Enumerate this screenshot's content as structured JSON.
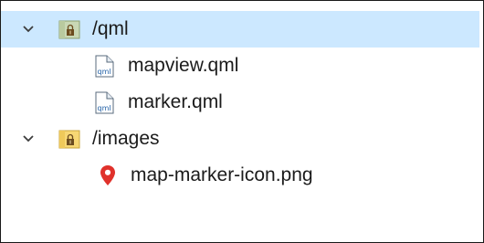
{
  "tree": {
    "folders": [
      {
        "label": "/qml",
        "expanded": true,
        "selected": true,
        "children": [
          {
            "label": "mapview.qml",
            "icon": "qml-file-icon"
          },
          {
            "label": "marker.qml",
            "icon": "qml-file-icon"
          }
        ]
      },
      {
        "label": "/images",
        "expanded": true,
        "selected": false,
        "children": [
          {
            "label": "map-marker-icon.png",
            "icon": "map-marker-icon"
          }
        ]
      }
    ],
    "file_badge_text": "qml"
  },
  "colors": {
    "selection": "#cce8ff",
    "folder_qml_body": "#c9d8b5",
    "folder_images_body": "#f7d774",
    "marker_red": "#e0312b",
    "text": "#1b1b1b"
  }
}
